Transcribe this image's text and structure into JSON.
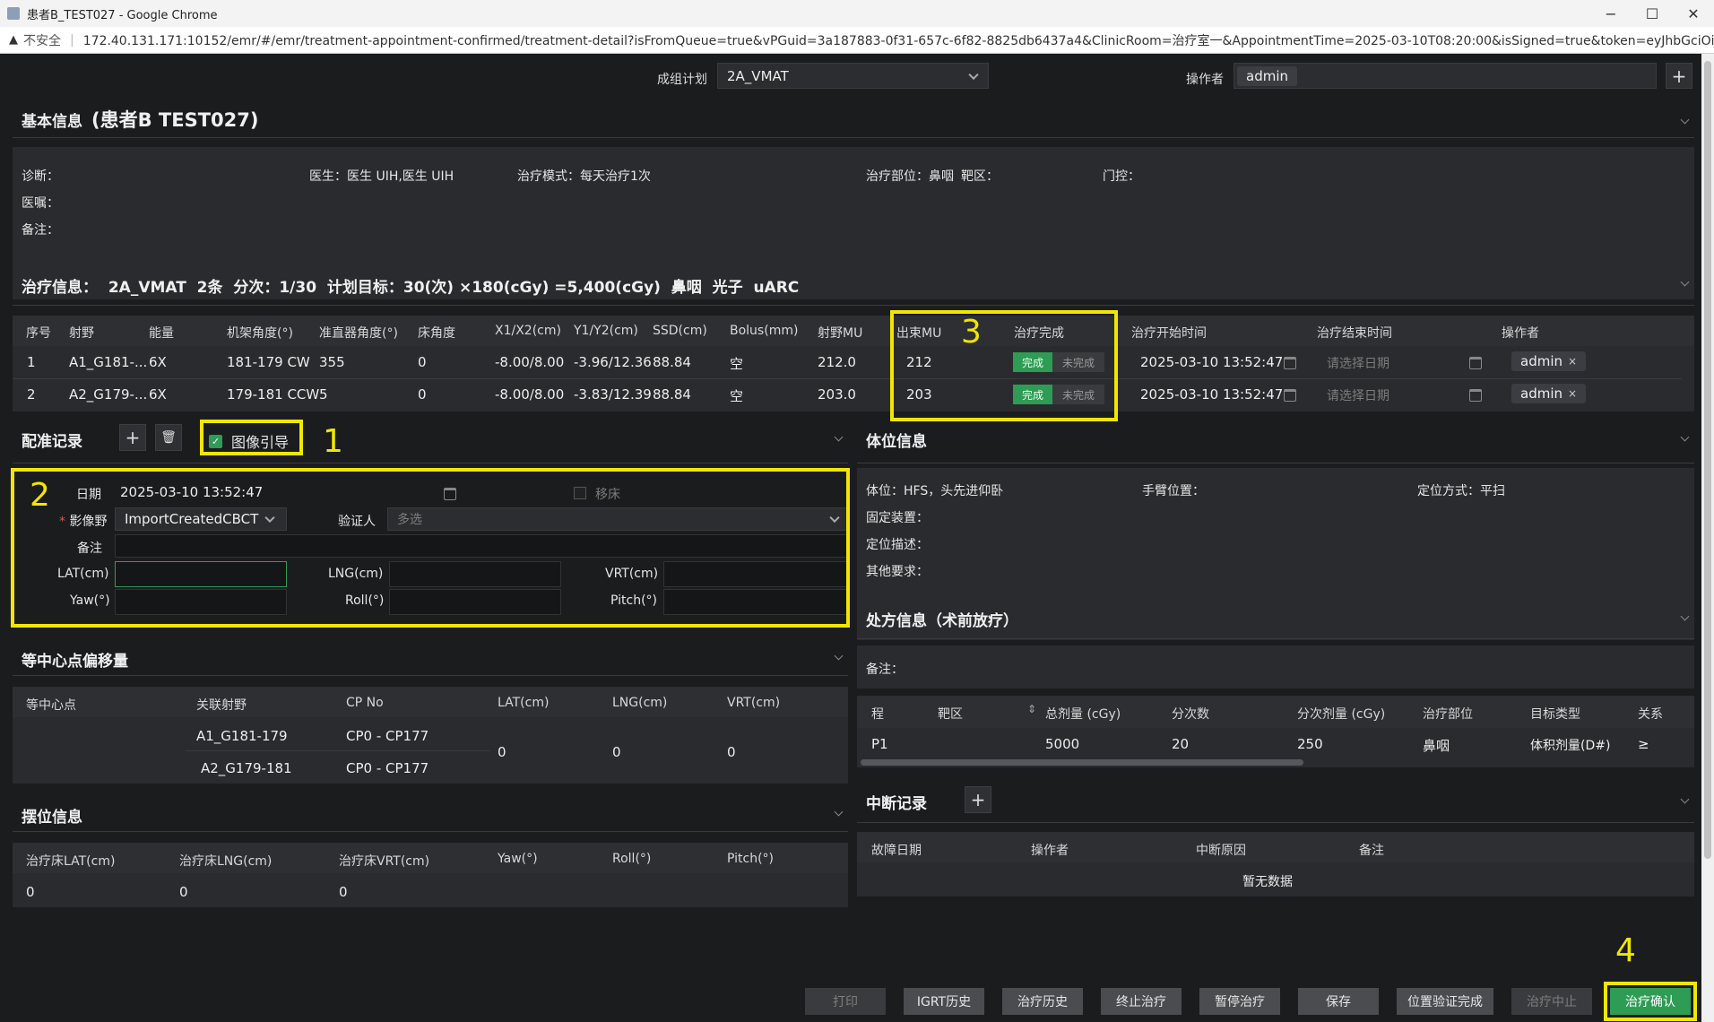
{
  "window": {
    "title": "患者B_TEST027 - Google Chrome",
    "minimize": "−",
    "maximize": "☐",
    "close": "✕"
  },
  "address": {
    "warning_icon": "▲",
    "insecure": "不安全",
    "url": "172.40.131.171:10152/emr/#/emr/treatment-appointment-confirmed/treatment-detail?isFromQueue=true&vPGuid=3a187883-0f31-657c-6f82-8825db6437a4&ClinicRoom=治疗室一&AppointmentTime=2025-03-10T08:20:00&isSigned=true&token=eyJhbGciOiJSUzl..."
  },
  "topbar": {
    "plan_label": "成组计划",
    "plan_value": "2A_VMAT",
    "operator_label": "操作者",
    "operator_value": "admin",
    "add": "+"
  },
  "basic": {
    "title": "基本信息",
    "patient": "(患者B TEST027)",
    "diagnosis": "诊断：",
    "doctor": "医生：医生 UIH,医生 UIH",
    "mode": "治疗模式：每天治疗1次",
    "site": "治疗部位：鼻咽",
    "target": "靶区：",
    "gating": "门控：",
    "orders": "医嘱：",
    "remark": "备注："
  },
  "treatment": {
    "summary": "治疗信息：  2A_VMAT  2条  分次：1/30  计划目标：30(次) ×180(cGy) =5,400(cGy)  鼻咽  光子  uARC",
    "headers": [
      "序号",
      "射野",
      "能量",
      "机架角度(°)",
      "准直器角度(°)",
      "床角度",
      "X1/X2(cm)",
      "Y1/Y2(cm)",
      "SSD(cm)",
      "Bolus(mm)",
      "射野MU",
      "出束MU",
      "治疗完成",
      "治疗开始时间",
      "治疗结束时间",
      "操作者"
    ],
    "rows": [
      {
        "no": "1",
        "field": "A1_G181-...",
        "energy": "6X",
        "gantry": "181-179 CW",
        "coll": "355",
        "couch": "0",
        "x": "-8.00/8.00",
        "y": "-3.96/12.36",
        "ssd": "88.84",
        "bolus": "空",
        "mu": "212.0",
        "out_mu": "212",
        "done": "完成",
        "undone": "未完成",
        "start": "2025-03-10 13:52:47",
        "end": "请选择日期",
        "operator": "admin"
      },
      {
        "no": "2",
        "field": "A2_G179-...",
        "energy": "6X",
        "gantry": "179-181 CCW",
        "coll": "5",
        "couch": "0",
        "x": "-8.00/8.00",
        "y": "-3.83/12.39",
        "ssd": "88.84",
        "bolus": "空",
        "mu": "203.0",
        "out_mu": "203",
        "done": "完成",
        "undone": "未完成",
        "start": "2025-03-10 13:52:47",
        "end": "请选择日期",
        "operator": "admin"
      }
    ]
  },
  "registration": {
    "title": "配准记录",
    "add": "+",
    "delete": "🗑",
    "image_guide": "图像引导",
    "date_label": "日期",
    "date_value": "2025-03-10 13:52:47",
    "move_bed": "移床",
    "image_field_label": "影像野",
    "image_field_value": "ImportCreatedCBCT",
    "verifier_label": "验证人",
    "verifier_placeholder": "多选",
    "note_label": "备注",
    "lat": "LAT(cm)",
    "lng": "LNG(cm)",
    "vrt": "VRT(cm)",
    "yaw": "Yaw(°)",
    "roll": "Roll(°)",
    "pitch": "Pitch(°)"
  },
  "isocenter": {
    "title": "等中心点偏移量",
    "headers": [
      "等中心点",
      "关联射野",
      "CP No",
      "LAT(cm)",
      "LNG(cm)",
      "VRT(cm)"
    ],
    "rows": [
      {
        "field": "A1_G181-179",
        "cp": "CP0 - CP177"
      },
      {
        "field": "A2_G179-181",
        "cp": "CP0 - CP177"
      }
    ],
    "lat": "0",
    "lng": "0",
    "vrt": "0"
  },
  "setup": {
    "title": "摆位信息",
    "headers": [
      "治疗床LAT(cm)",
      "治疗床LNG(cm)",
      "治疗床VRT(cm)",
      "Yaw(°)",
      "Roll(°)",
      "Pitch(°)"
    ],
    "values": [
      "0",
      "0",
      "0"
    ]
  },
  "position": {
    "title": "体位信息",
    "posture": "体位：HFS，头先进仰卧",
    "arm": "手臂位置：",
    "method": "定位方式：平扫",
    "fixture": "固定装置：",
    "desc": "定位描述：",
    "other": "其他要求："
  },
  "prescription": {
    "title": "处方信息（术前放疗）",
    "remark": "备注：",
    "headers": [
      "程",
      "靶区",
      "总剂量 (cGy)",
      "分次数",
      "分次剂量 (cGy)",
      "治疗部位",
      "目标类型",
      "关系"
    ],
    "row": [
      "P1",
      "",
      "5000",
      "20",
      "250",
      "鼻咽",
      "体积剂量(D#)",
      "≥"
    ]
  },
  "interrupt": {
    "title": "中断记录",
    "add": "+",
    "headers": [
      "故障日期",
      "操作者",
      "中断原因",
      "备注"
    ],
    "empty": "暂无数据"
  },
  "footer": {
    "print": "打印",
    "igrt": "IGRT历史",
    "history": "治疗历史",
    "terminate": "终止治疗",
    "pause": "暂停治疗",
    "save": "保存",
    "verify": "位置验证完成",
    "stop": "治疗中止",
    "confirm": "治疗确认"
  },
  "annotations": [
    "1",
    "2",
    "3",
    "4"
  ]
}
